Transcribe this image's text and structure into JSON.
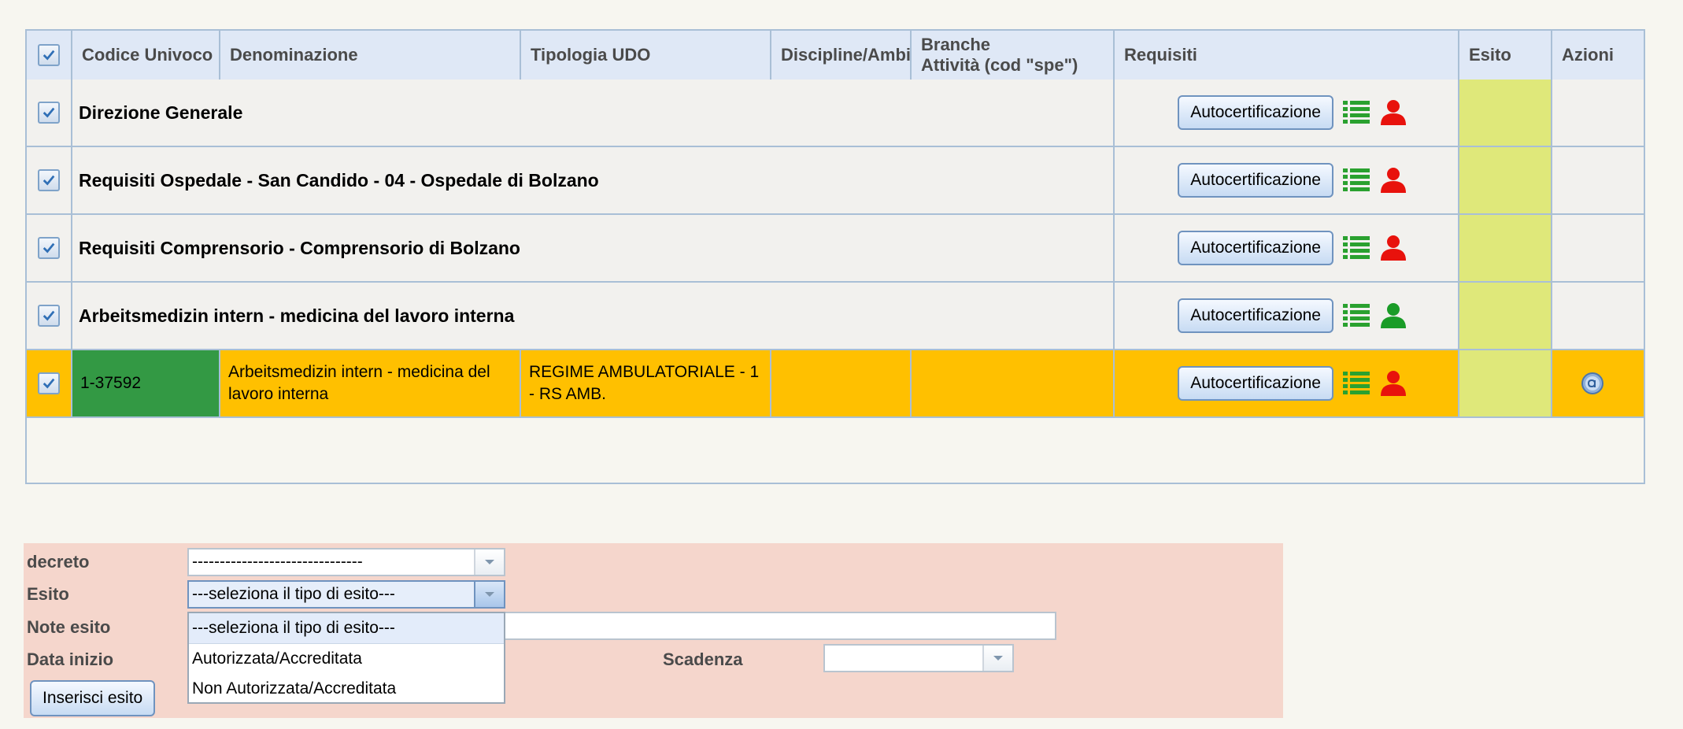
{
  "grid": {
    "columns": {
      "codice": "Codice Univoco",
      "denominazione": "Denominazione",
      "tipologia": "Tipologia UDO",
      "discipline": "Discipline/Ambiti",
      "branche_line1": "Branche",
      "branche_line2": "Attività (cod \"spe\")",
      "requisiti": "Requisiti",
      "esito": "Esito",
      "azioni": "Azioni"
    },
    "groups": [
      {
        "title": "Direzione Generale",
        "button": "Autocertificazione",
        "user_icon_color": "#e8120c"
      },
      {
        "title": "Requisiti Ospedale - San Candido - 04 - Ospedale di Bolzano",
        "button": "Autocertificazione",
        "user_icon_color": "#e8120c"
      },
      {
        "title": "Requisiti Comprensorio - Comprensorio di Bolzano",
        "button": "Autocertificazione",
        "user_icon_color": "#e8120c"
      },
      {
        "title": "Arbeitsmedizin intern - medicina del lavoro interna",
        "button": "Autocertificazione",
        "user_icon_color": "#1a9c27"
      }
    ],
    "data_row": {
      "codice": "1-37592",
      "denominazione": "Arbeitsmedizin intern - medicina del lavoro interna",
      "tipologia": "REGIME AMBULATORIALE - 1 - RS AMB.",
      "button": "Autocertificazione",
      "user_icon_color": "#e8120c",
      "codice_bg": "#339944",
      "row_bg": "#ffc000"
    }
  },
  "form": {
    "decreto_label": "decreto",
    "decreto_value": "-------------------------------",
    "esito_label": "Esito",
    "esito_value": "---seleziona il tipo di esito---",
    "note_label": "Note esito",
    "data_inizio_label": "Data inizio",
    "scadenza_label": "Scadenza",
    "submit_label": "Inserisci esito",
    "esito_options": [
      "---seleziona il tipo di esito---",
      "Autorizzata/Accreditata",
      "Non Autorizzata/Accreditata"
    ]
  },
  "icons": {
    "list_icon": "list-icon",
    "user_icon": "user-icon",
    "action_icon": "info-circle-icon",
    "checkbox_icon": "checkbox-checked-icon",
    "dropdown_arrow": "chevron-down-icon"
  },
  "colors": {
    "header_bg": "#dfe8f6",
    "esito_bg": "#dfe87a",
    "highlight_row": "#ffc000",
    "form_bg": "#f5d6cc",
    "list_icon_color": "#2aa12f"
  }
}
